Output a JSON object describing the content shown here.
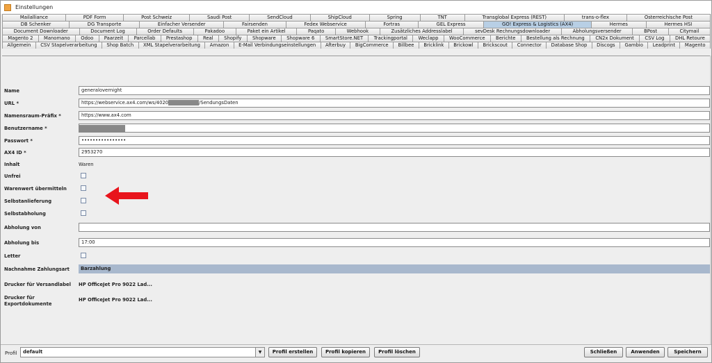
{
  "window": {
    "title": "Einstellungen"
  },
  "tab_rows": [
    [
      "Mailalliance",
      "PDF Form",
      "Post Schweiz",
      "Saudi Post",
      "SendCloud",
      "ShipCloud",
      "Spring",
      "TNT",
      "Transglobal Express (REST)",
      "trans-o-flex",
      "Österreichische Post"
    ],
    [
      "DB Schenker",
      "DG Transporte",
      "Einfacher Versender",
      "Fairsenden",
      "Fedex Webservice",
      "Fortras",
      "GEL Express",
      "GO! Express & Logistics (AX4)",
      "Hermes",
      "Hermes HSI"
    ],
    [
      "Document Downloader",
      "Document Log",
      "Order Defaults",
      "Pakadoo",
      "Paket ein Artikel",
      "Paqato",
      "Webhook",
      "Zusätzliches Addresslabel",
      "sevDesk Rechnungsdownloader",
      "Abholungsversender",
      "BPost",
      "Citymail"
    ],
    [
      "Magento 2",
      "Manomano",
      "Odoo",
      "Paarzeit",
      "Parcellab",
      "Prestashop",
      "Real",
      "Shopify",
      "Shopware",
      "Shopware 6",
      "SmartStore.NET",
      "Trackingportal",
      "Weclapp",
      "WooCommerce",
      "Berichte",
      "Bestellung als Rechnung",
      "CN2x Dokument",
      "CSV Log",
      "DHL Retoure"
    ],
    [
      "Allgemein",
      "CSV Stapelverarbeitung",
      "Shop Batch",
      "XML Stapelverarbeitung",
      "Amazon",
      "E-Mail Verbindungseinstellungen",
      "Afterbuy",
      "BigCommerce",
      "Billbee",
      "Bricklink",
      "Brickowl",
      "Brickscout",
      "Connector",
      "Database Shop",
      "Discogs",
      "Gambio",
      "Leadprint",
      "Magento"
    ]
  ],
  "active_tab": "GO! Express & Logistics (AX4)",
  "form": {
    "name_label": "Name",
    "name_value": "generalovernight",
    "url_label": "URL *",
    "url_prefix": "https://webservice.ax4.com/ws/4020",
    "url_suffix": "/SendungsDaten",
    "ns_label": "Namensraum-Präfix *",
    "ns_value": "https://www.ax4.com",
    "user_label": "Benutzername *",
    "pass_label": "Passwort *",
    "pass_value": "••••••••••••••••",
    "ax4_label": "AX4 ID *",
    "ax4_value": "2953270",
    "inhalt_label": "Inhalt",
    "inhalt_value": "Waren",
    "unfrei_label": "Unfrei",
    "warenwert_label": "Warenwert übermitteln",
    "selbstanlieferung_label": "Selbstanlieferung",
    "selbstabholung_label": "Selbstabholung",
    "abholung_von_label": "Abholung von",
    "abholung_von_value": "",
    "abholung_bis_label": "Abholung bis",
    "abholung_bis_value": "17:00",
    "letter_label": "Letter",
    "nachnahme_label": "Nachnahme Zahlungsart",
    "nachnahme_value": "Barzahlung",
    "drucker_versand_label": "Drucker für Versandlabel",
    "drucker_versand_value": "HP OfficeJet Pro 9022 Lad...",
    "drucker_export_label1": "Drucker für",
    "drucker_export_label2": "Exportdokumente",
    "drucker_export_value": "HP OfficeJet Pro 9022 Lad..."
  },
  "footer": {
    "profil_label": "Profil",
    "profil_value": "default",
    "profil_erstellen": "Profil erstellen",
    "profil_kopieren": "Profil kopieren",
    "profil_loeschen": "Profil löschen",
    "schliessen": "Schließen",
    "anwenden": "Anwenden",
    "speichern": "Speichern"
  },
  "colors": {
    "active_tab": "#b8cfe5",
    "arrow": "#e8141c",
    "combo": "#a8b8cd"
  }
}
